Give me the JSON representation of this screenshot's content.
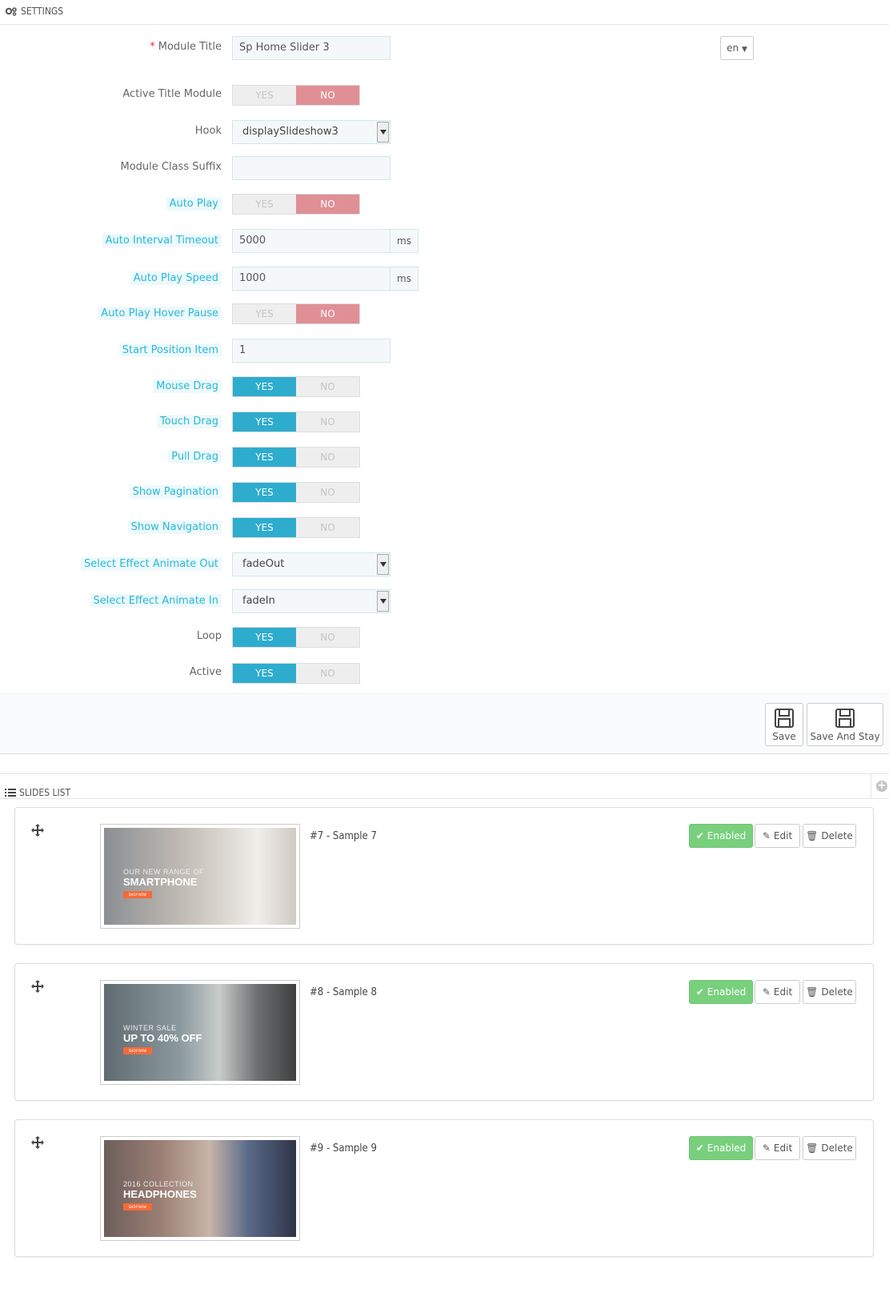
{
  "settings": {
    "heading": "SETTINGS",
    "lang": "en",
    "fields": [
      {
        "key": "module_title",
        "label": "Module Title",
        "required": true,
        "type": "text",
        "value": "Sp Home Slider 3"
      },
      {
        "key": "active_title_module",
        "label": "Active Title Module",
        "type": "toggle",
        "yes": "YES",
        "no": "NO",
        "value": "no"
      },
      {
        "key": "hook",
        "label": "Hook",
        "type": "select",
        "value": "displaySlideshow3"
      },
      {
        "key": "module_class_suffix",
        "label": "Module Class Suffix",
        "type": "text",
        "value": ""
      },
      {
        "key": "auto_play",
        "label": "Auto Play",
        "hint": true,
        "type": "toggle",
        "yes": "YES",
        "no": "NO",
        "value": "no"
      },
      {
        "key": "auto_interval_timeout",
        "label": "Auto Interval Timeout",
        "hint": true,
        "type": "text-addon",
        "value": "5000",
        "addon": "ms"
      },
      {
        "key": "auto_play_speed",
        "label": "Auto Play Speed",
        "hint": true,
        "type": "text-addon",
        "value": "1000",
        "addon": "ms"
      },
      {
        "key": "auto_play_hover_pause",
        "label": "Auto Play Hover Pause",
        "hint": true,
        "type": "toggle",
        "yes": "YES",
        "no": "NO",
        "value": "no"
      },
      {
        "key": "start_position_item",
        "label": "Start Position Item",
        "hint": true,
        "type": "text",
        "value": "1"
      },
      {
        "key": "mouse_drag",
        "label": "Mouse Drag",
        "hint": true,
        "type": "toggle",
        "yes": "YES",
        "no": "NO",
        "value": "yes"
      },
      {
        "key": "touch_drag",
        "label": "Touch Drag",
        "hint": true,
        "type": "toggle",
        "yes": "YES",
        "no": "NO",
        "value": "yes"
      },
      {
        "key": "pull_drag",
        "label": "Pull Drag",
        "hint": true,
        "type": "toggle",
        "yes": "YES",
        "no": "NO",
        "value": "yes"
      },
      {
        "key": "show_pagination",
        "label": "Show Pagination",
        "hint": true,
        "type": "toggle",
        "yes": "YES",
        "no": "NO",
        "value": "yes"
      },
      {
        "key": "show_navigation",
        "label": "Show Navigation",
        "hint": true,
        "type": "toggle",
        "yes": "YES",
        "no": "NO",
        "value": "yes"
      },
      {
        "key": "effect_animate_out",
        "label": "Select Effect Animate Out",
        "hint": true,
        "type": "select",
        "value": "fadeOut"
      },
      {
        "key": "effect_animate_in",
        "label": "Select Effect Animate In",
        "hint": true,
        "type": "select",
        "value": "fadeIn"
      },
      {
        "key": "loop",
        "label": "Loop",
        "type": "toggle",
        "yes": "YES",
        "no": "NO",
        "value": "yes"
      },
      {
        "key": "active",
        "label": "Active",
        "type": "toggle",
        "yes": "YES",
        "no": "NO",
        "value": "yes"
      }
    ],
    "save_label": "Save",
    "save_stay_label": "Save And Stay"
  },
  "slides_list": {
    "heading": "SLIDES LIST",
    "slides": [
      {
        "title": "#7 - Sample 7",
        "status_label": "Enabled",
        "edit_label": "Edit",
        "delete_label": "Delete",
        "thumb_line1": "OUR NEW RANGE OF",
        "thumb_line2": "SMARTPHONE",
        "thumb_button": "SHOP NOW"
      },
      {
        "title": "#8 - Sample 8",
        "status_label": "Enabled",
        "edit_label": "Edit",
        "delete_label": "Delete",
        "thumb_line1": "WINTER SALE",
        "thumb_line2": "UP TO 40% OFF",
        "thumb_button": "SHOP NOW"
      },
      {
        "title": "#9 - Sample 9",
        "status_label": "Enabled",
        "edit_label": "Edit",
        "delete_label": "Delete",
        "thumb_line1": "2016 COLLECTION",
        "thumb_line2": "HEADPHONES",
        "thumb_button": "SHOP NOW"
      }
    ]
  },
  "colors": {
    "toggle_yes_active": "#2eacce",
    "toggle_no_active": "#e08f95",
    "hint_label": "#25b9d7",
    "enabled_button": "#78d07d"
  }
}
